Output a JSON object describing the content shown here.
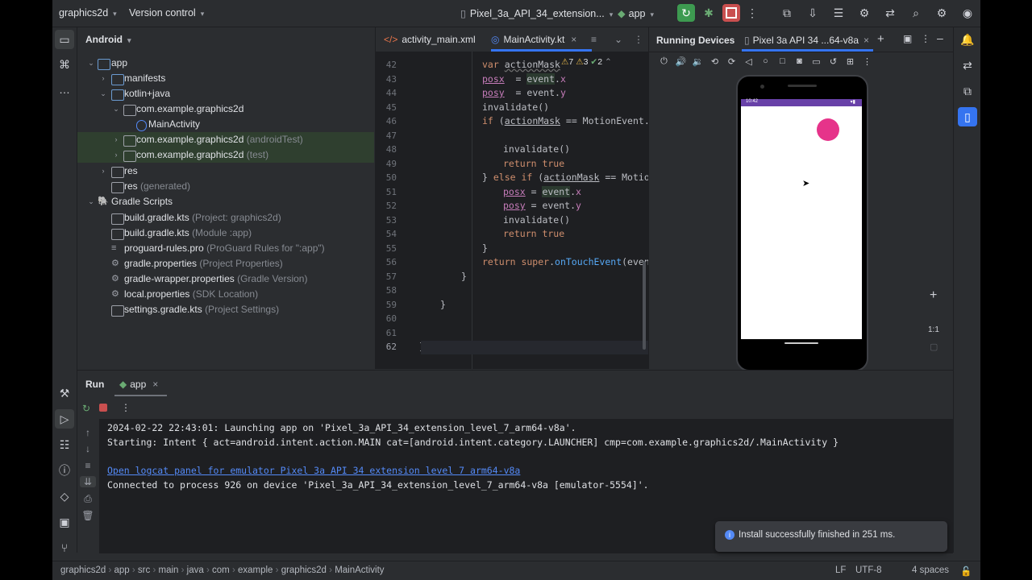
{
  "topbar": {
    "project": "graphics2d",
    "vcs": "Version control",
    "device": "Pixel_3a_API_34_extension...",
    "run_config": "app"
  },
  "project_panel": {
    "view": "Android",
    "items": [
      {
        "label": "app",
        "hint": ""
      },
      {
        "label": "manifests",
        "hint": ""
      },
      {
        "label": "kotlin+java",
        "hint": ""
      },
      {
        "label": "com.example.graphics2d",
        "hint": ""
      },
      {
        "label": "MainActivity",
        "hint": ""
      },
      {
        "label": "com.example.graphics2d",
        "hint": "(androidTest)"
      },
      {
        "label": "com.example.graphics2d",
        "hint": "(test)"
      },
      {
        "label": "res",
        "hint": ""
      },
      {
        "label": "res",
        "hint": "(generated)"
      },
      {
        "label": "Gradle Scripts",
        "hint": ""
      },
      {
        "label": "build.gradle.kts",
        "hint": "(Project: graphics2d)"
      },
      {
        "label": "build.gradle.kts",
        "hint": "(Module :app)"
      },
      {
        "label": "proguard-rules.pro",
        "hint": "(ProGuard Rules for \":app\")"
      },
      {
        "label": "gradle.properties",
        "hint": "(Project Properties)"
      },
      {
        "label": "gradle-wrapper.properties",
        "hint": "(Gradle Version)"
      },
      {
        "label": "local.properties",
        "hint": "(SDK Location)"
      },
      {
        "label": "settings.gradle.kts",
        "hint": "(Project Settings)"
      }
    ]
  },
  "editor": {
    "tabs": [
      "activity_main.xml",
      "MainActivity.kt"
    ],
    "inspections": {
      "warnings": "7",
      "weak": "3",
      "ok": "2"
    },
    "line_numbers": [
      "42",
      "43",
      "44",
      "45",
      "46",
      "47",
      "48",
      "49",
      "50",
      "51",
      "52",
      "53",
      "54",
      "55",
      "56",
      "57",
      "58",
      "59",
      "60",
      "61",
      "62"
    ]
  },
  "running_devices": {
    "title": "Running Devices",
    "device_tab": "Pixel 3a API 34 ...64-v8a",
    "clock": "10:42",
    "zoom_label": "1:1",
    "ball_color": "#e6338a"
  },
  "run_panel": {
    "title": "Run",
    "tab": "app",
    "console": [
      "2024-02-22 22:43:01: Launching app on 'Pixel_3a_API_34_extension_level_7_arm64-v8a'.",
      "Starting: Intent { act=android.intent.action.MAIN cat=[android.intent.category.LAUNCHER] cmp=com.example.graphics2d/.MainActivity }",
      "Open logcat panel for emulator Pixel 3a API 34 extension level 7 arm64-v8a",
      "Connected to process 926 on device 'Pixel_3a_API_34_extension_level_7_arm64-v8a [emulator-5554]'."
    ]
  },
  "toast": "Install successfully finished in 251 ms.",
  "breadcrumbs": [
    "graphics2d",
    "app",
    "src",
    "main",
    "java",
    "com",
    "example",
    "graphics2d",
    "MainActivity"
  ],
  "status": {
    "line_sep": "LF",
    "encoding": "UTF-8",
    "indent": "4 spaces"
  }
}
